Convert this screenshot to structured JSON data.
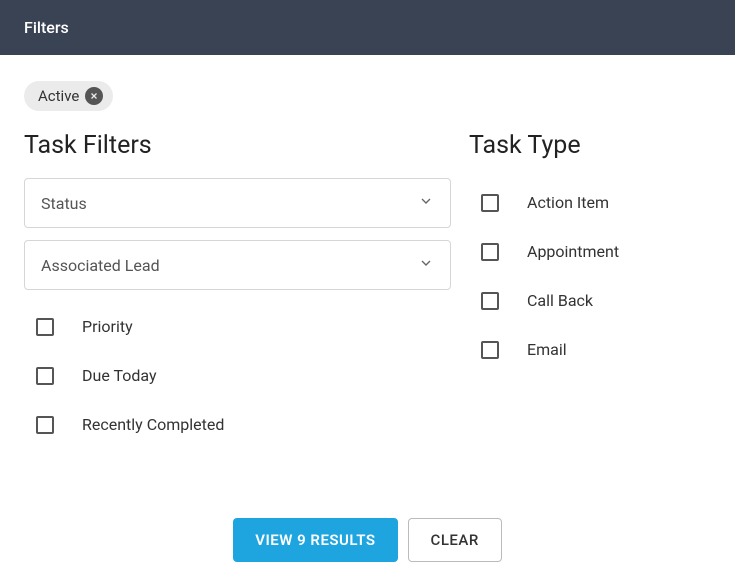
{
  "header": {
    "title": "Filters"
  },
  "chip": {
    "label": "Active"
  },
  "left": {
    "title": "Task Filters",
    "selects": [
      {
        "label": "Status"
      },
      {
        "label": "Associated Lead"
      }
    ],
    "checks": [
      {
        "label": "Priority"
      },
      {
        "label": "Due Today"
      },
      {
        "label": "Recently Completed"
      }
    ]
  },
  "right": {
    "title": "Task Type",
    "checks": [
      {
        "label": "Action Item"
      },
      {
        "label": "Appointment"
      },
      {
        "label": "Call Back"
      },
      {
        "label": "Email"
      }
    ]
  },
  "footer": {
    "primary": "VIEW 9 RESULTS",
    "secondary": "CLEAR"
  }
}
